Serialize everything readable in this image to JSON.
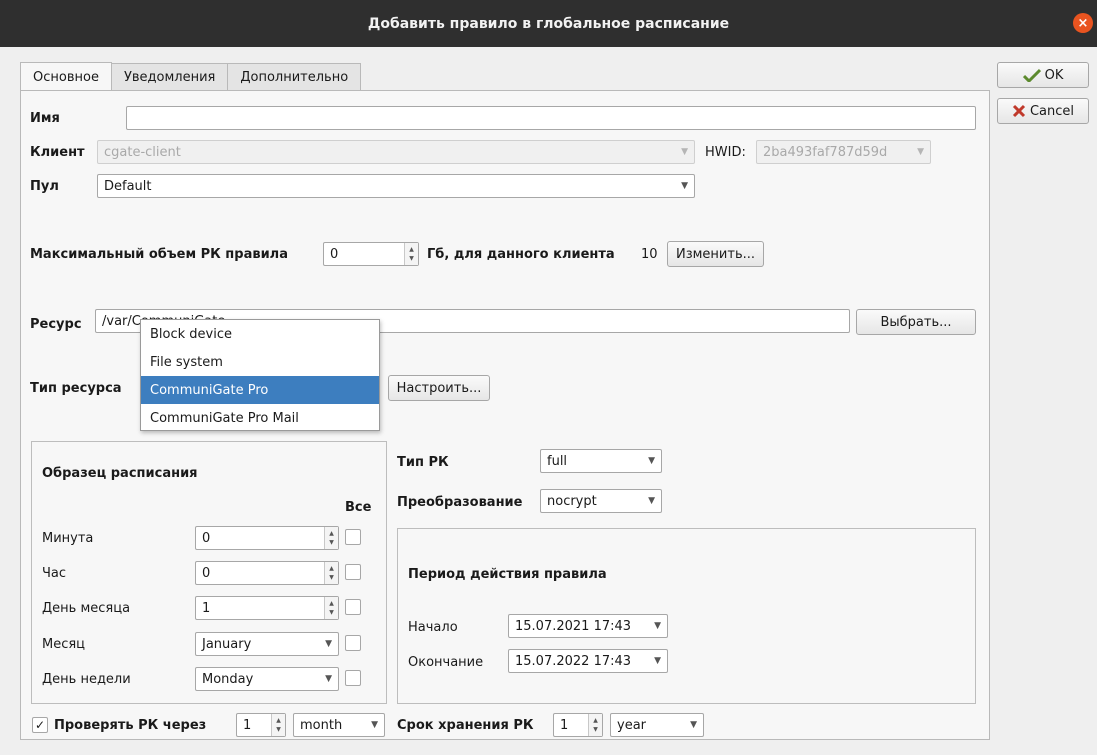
{
  "window": {
    "title": "Добавить правило в глобальное расписание",
    "close_glyph": "×"
  },
  "tabs": [
    {
      "label": "Основное",
      "active": true
    },
    {
      "label": "Уведомления",
      "active": false
    },
    {
      "label": "Дополнительно",
      "active": false
    }
  ],
  "actions": {
    "ok_label": "OK",
    "cancel_label": "Cancel"
  },
  "form": {
    "name_label": "Имя",
    "name_value": "",
    "client_label": "Клиент",
    "client_value": "cgate-client",
    "hwid_label": "HWID:",
    "hwid_value": "2ba493faf787d59d",
    "pool_label": "Пул",
    "pool_value": "Default",
    "max_volume_label": "Максимальный объем РК правила",
    "max_volume_value": "0",
    "client_quota_label": "Гб, для данного клиента",
    "client_quota_value": "10",
    "change_button": "Изменить...",
    "resource_label": "Ресурс",
    "resource_value": "/var/CommuniGate",
    "choose_button": "Выбрать...",
    "resource_type_label": "Тип ресурса",
    "configure_button": "Настроить..."
  },
  "resource_type_dropdown": {
    "options": [
      "Block device",
      "File system",
      "CommuniGate Pro",
      "CommuniGate Pro Mail"
    ],
    "selected_index": 2
  },
  "schedule": {
    "title": "Образец расписания",
    "all_label": "Все",
    "minute_label": "Минута",
    "minute_value": "0",
    "hour_label": "Час",
    "hour_value": "0",
    "day_label": "День месяца",
    "day_value": "1",
    "month_label": "Месяц",
    "month_value": "January",
    "weekday_label": "День недели",
    "weekday_value": "Monday"
  },
  "backup": {
    "type_label": "Тип РК",
    "type_value": "full",
    "transform_label": "Преобразование",
    "transform_value": "nocrypt"
  },
  "period": {
    "title": "Период действия правила",
    "start_label": "Начало",
    "start_value": "15.07.2021 17:43",
    "end_label": "Окончание",
    "end_value": "15.07.2022 17:43"
  },
  "footer": {
    "check_label": "Проверять РК через",
    "check_checked": "✓",
    "check_value": "1",
    "check_unit": "month",
    "retention_label": "Срок хранения РК",
    "retention_value": "1",
    "retention_unit": "year"
  },
  "colors": {
    "titlebar": "#2f2f2f",
    "close": "#e95420",
    "selection": "#3d7ebf"
  }
}
